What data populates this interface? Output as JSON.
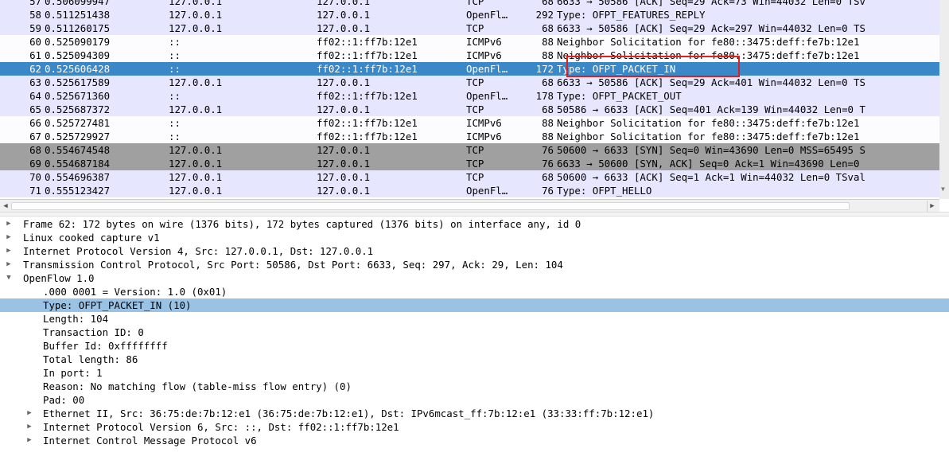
{
  "packet_list": {
    "rows": [
      {
        "no": "57",
        "time": "0.506099947",
        "src": "127.0.0.1",
        "dst": "127.0.0.1",
        "proto": "TCP",
        "len": "68",
        "info": "6633 → 50586 [ACK] Seq=29 Ack=73 Win=44032 Len=0 TSv",
        "style": "tcp"
      },
      {
        "no": "58",
        "time": "0.511251438",
        "src": "127.0.0.1",
        "dst": "127.0.0.1",
        "proto": "OpenFl…",
        "len": "292",
        "info": "Type: OFPT_FEATURES_REPLY",
        "style": "of"
      },
      {
        "no": "59",
        "time": "0.511260175",
        "src": "127.0.0.1",
        "dst": "127.0.0.1",
        "proto": "TCP",
        "len": "68",
        "info": "6633 → 50586 [ACK] Seq=29 Ack=297 Win=44032 Len=0 TS",
        "style": "tcp"
      },
      {
        "no": "60",
        "time": "0.525090179",
        "src": "::",
        "dst": "ff02::1:ff7b:12e1",
        "proto": "ICMPv6",
        "len": "88",
        "info": "Neighbor Solicitation for fe80::3475:deff:fe7b:12e1",
        "style": "icmp"
      },
      {
        "no": "61",
        "time": "0.525094309",
        "src": "::",
        "dst": "ff02::1:ff7b:12e1",
        "proto": "ICMPv6",
        "len": "88",
        "info": "Neighbor Solicitation for fe80::3475:deff:fe7b:12e1",
        "style": "icmp"
      },
      {
        "no": "62",
        "time": "0.525606428",
        "src": "::",
        "dst": "ff02::1:ff7b:12e1",
        "proto": "OpenFl…",
        "len": "172",
        "info": "Type: OFPT_PACKET_IN",
        "style": "sel"
      },
      {
        "no": "63",
        "time": "0.525617589",
        "src": "127.0.0.1",
        "dst": "127.0.0.1",
        "proto": "TCP",
        "len": "68",
        "info": "6633 → 50586 [ACK] Seq=29 Ack=401 Win=44032 Len=0 TS",
        "style": "tcp"
      },
      {
        "no": "64",
        "time": "0.525671360",
        "src": "::",
        "dst": "ff02::1:ff7b:12e1",
        "proto": "OpenFl…",
        "len": "178",
        "info": "Type: OFPT_PACKET_OUT",
        "style": "of"
      },
      {
        "no": "65",
        "time": "0.525687372",
        "src": "127.0.0.1",
        "dst": "127.0.0.1",
        "proto": "TCP",
        "len": "68",
        "info": "50586 → 6633 [ACK] Seq=401 Ack=139 Win=44032 Len=0 T",
        "style": "tcp"
      },
      {
        "no": "66",
        "time": "0.525727481",
        "src": "::",
        "dst": "ff02::1:ff7b:12e1",
        "proto": "ICMPv6",
        "len": "88",
        "info": "Neighbor Solicitation for fe80::3475:deff:fe7b:12e1",
        "style": "icmp"
      },
      {
        "no": "67",
        "time": "0.525729927",
        "src": "::",
        "dst": "ff02::1:ff7b:12e1",
        "proto": "ICMPv6",
        "len": "88",
        "info": "Neighbor Solicitation for fe80::3475:deff:fe7b:12e1",
        "style": "icmp"
      },
      {
        "no": "68",
        "time": "0.554674548",
        "src": "127.0.0.1",
        "dst": "127.0.0.1",
        "proto": "TCP",
        "len": "76",
        "info": "50600 → 6633 [SYN] Seq=0 Win=43690 Len=0 MSS=65495 S",
        "style": "syn"
      },
      {
        "no": "69",
        "time": "0.554687184",
        "src": "127.0.0.1",
        "dst": "127.0.0.1",
        "proto": "TCP",
        "len": "76",
        "info": "6633 → 50600 [SYN, ACK] Seq=0 Ack=1 Win=43690 Len=0",
        "style": "syn"
      },
      {
        "no": "70",
        "time": "0.554696387",
        "src": "127.0.0.1",
        "dst": "127.0.0.1",
        "proto": "TCP",
        "len": "68",
        "info": "50600 → 6633 [ACK] Seq=1 Ack=1 Win=44032 Len=0 TSval",
        "style": "tcp"
      },
      {
        "no": "71",
        "time": "0.555123427",
        "src": "127.0.0.1",
        "dst": "127.0.0.1",
        "proto": "OpenFl…",
        "len": "76",
        "info": "Type: OFPT_HELLO",
        "style": "of"
      }
    ]
  },
  "detail_tree": {
    "rows": [
      {
        "text": "Frame 62: 172 bytes on wire (1376 bits), 172 bytes captured (1376 bits) on interface any, id 0",
        "level": "0",
        "arrow": "collapsed"
      },
      {
        "text": "Linux cooked capture v1",
        "level": "0",
        "arrow": "collapsed"
      },
      {
        "text": "Internet Protocol Version 4, Src: 127.0.0.1, Dst: 127.0.0.1",
        "level": "0",
        "arrow": "collapsed"
      },
      {
        "text": "Transmission Control Protocol, Src Port: 50586, Dst Port: 6633, Seq: 297, Ack: 29, Len: 104",
        "level": "0",
        "arrow": "collapsed"
      },
      {
        "text": "OpenFlow 1.0",
        "level": "0",
        "arrow": "expanded"
      },
      {
        "text": ".000 0001 = Version: 1.0 (0x01)",
        "level": "1",
        "arrow": "none"
      },
      {
        "text": "Type: OFPT_PACKET_IN (10)",
        "level": "1",
        "arrow": "none",
        "selected": true
      },
      {
        "text": "Length: 104",
        "level": "1",
        "arrow": "none"
      },
      {
        "text": "Transaction ID: 0",
        "level": "1",
        "arrow": "none"
      },
      {
        "text": "Buffer Id: 0xffffffff",
        "level": "1",
        "arrow": "none"
      },
      {
        "text": "Total length: 86",
        "level": "1",
        "arrow": "none"
      },
      {
        "text": "In port: 1",
        "level": "1",
        "arrow": "none"
      },
      {
        "text": "Reason: No matching flow (table-miss flow entry) (0)",
        "level": "1",
        "arrow": "none"
      },
      {
        "text": "Pad: 00",
        "level": "1",
        "arrow": "none"
      },
      {
        "text": "Ethernet II, Src: 36:75:de:7b:12:e1 (36:75:de:7b:12:e1), Dst: IPv6mcast_ff:7b:12:e1 (33:33:ff:7b:12:e1)",
        "level": "1p",
        "arrow": "collapsed"
      },
      {
        "text": "Internet Protocol Version 6, Src: ::, Dst: ff02::1:ff7b:12e1",
        "level": "1p",
        "arrow": "collapsed"
      },
      {
        "text": "Internet Control Message Protocol v6",
        "level": "1p",
        "arrow": "collapsed"
      }
    ]
  },
  "icons": {
    "collapsed": "triangle-right-icon",
    "expanded": "triangle-down-icon",
    "scroll_left": "scroll-left-arrow-icon",
    "scroll_right": "scroll-right-arrow-icon",
    "scroll_down": "scroll-down-arrow-icon"
  },
  "colors": {
    "selected_row": "#3b88c8",
    "tcp_row": "#e7e6ff",
    "syn_row": "#a0a0a0",
    "tree_selected": "#9ac2e4",
    "annotation_box": "#e02020"
  }
}
